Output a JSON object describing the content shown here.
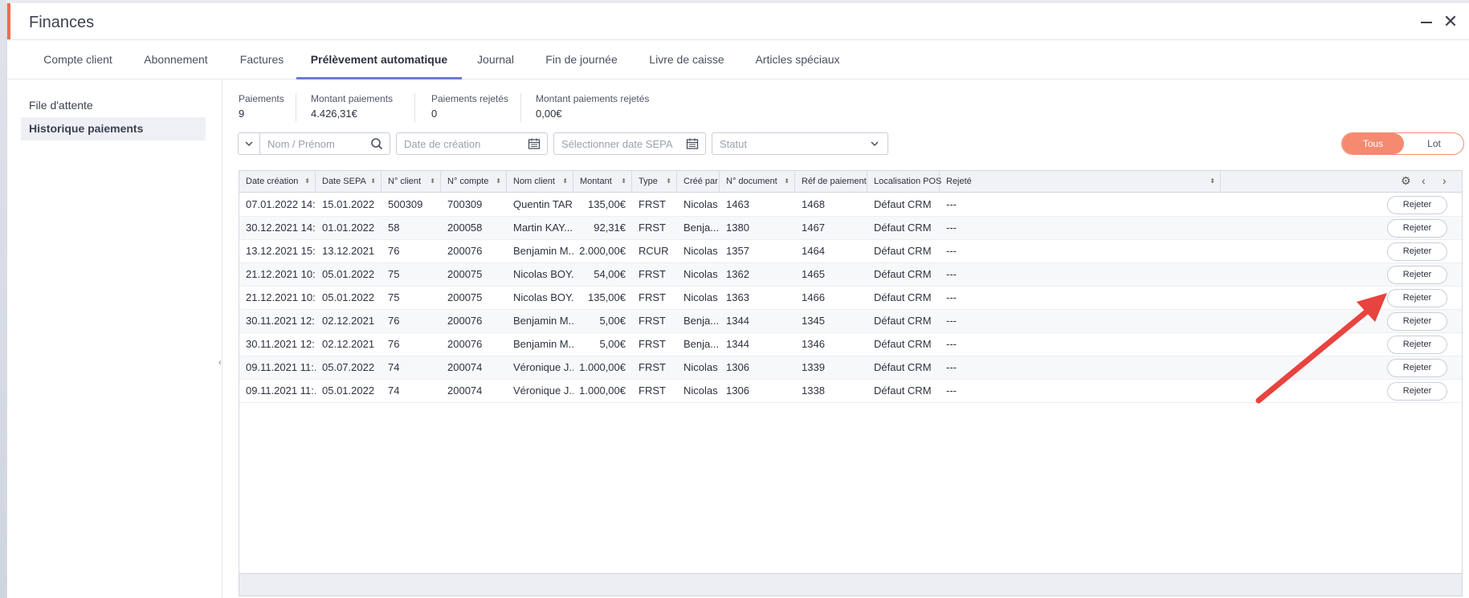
{
  "window": {
    "title": "Finances",
    "minimize_label": "—",
    "close_label": "✕"
  },
  "tabs": [
    {
      "label": "Compte client"
    },
    {
      "label": "Abonnement"
    },
    {
      "label": "Factures"
    },
    {
      "label": "Prélèvement automatique"
    },
    {
      "label": "Journal"
    },
    {
      "label": "Fin de journée"
    },
    {
      "label": "Livre de caisse"
    },
    {
      "label": "Articles spéciaux"
    }
  ],
  "active_tab": "Prélèvement automatique",
  "sidebar": {
    "items": [
      {
        "label": "File d'attente"
      },
      {
        "label": "Historique paiements"
      }
    ],
    "active": "Historique paiements"
  },
  "stats": [
    {
      "label": "Paiements",
      "value": "9"
    },
    {
      "label": "Montant paiements",
      "value": "4.426,31€"
    },
    {
      "label": "Paiements rejetés",
      "value": "0"
    },
    {
      "label": "Montant paiements rejetés",
      "value": "0,00€"
    }
  ],
  "filters": {
    "name_placeholder": "Nom / Prénom",
    "created_placeholder": "Date de création",
    "sepa_placeholder": "Sélectionner date SEPA",
    "status_placeholder": "Statut"
  },
  "toggle": {
    "all_label": "Tous",
    "batch_label": "Lot"
  },
  "table": {
    "columns": [
      "Date création",
      "Date SEPA",
      "N° client",
      "N° compte",
      "Nom client",
      "Montant",
      "Type",
      "Créé par",
      "N° document",
      "Réf de paiement",
      "Localisation POS",
      "Rejeté"
    ],
    "action_label": "Rejeter",
    "rows": [
      [
        "07.01.2022 14:...",
        "15.01.2022",
        "500309",
        "700309",
        "Quentin TAR...",
        "135,00€",
        "FRST",
        "Nicolas",
        "1463",
        "1468",
        "Défaut CRM",
        "---"
      ],
      [
        "30.12.2021 14:...",
        "01.01.2022",
        "58",
        "200058",
        "Martin KAY...",
        "92,31€",
        "FRST",
        "Benja...",
        "1380",
        "1467",
        "Défaut CRM",
        "---"
      ],
      [
        "13.12.2021 15:...",
        "13.12.2021",
        "76",
        "200076",
        "Benjamin M...",
        "2.000,00€",
        "RCUR",
        "Nicolas",
        "1357",
        "1464",
        "Défaut CRM",
        "---"
      ],
      [
        "21.12.2021 10:...",
        "05.01.2022",
        "75",
        "200075",
        "Nicolas BOY...",
        "54,00€",
        "FRST",
        "Nicolas",
        "1362",
        "1465",
        "Défaut CRM",
        "---"
      ],
      [
        "21.12.2021 10:...",
        "05.01.2022",
        "75",
        "200075",
        "Nicolas BOY...",
        "135,00€",
        "FRST",
        "Nicolas",
        "1363",
        "1466",
        "Défaut CRM",
        "---"
      ],
      [
        "30.11.2021 12:...",
        "02.12.2021",
        "76",
        "200076",
        "Benjamin M...",
        "5,00€",
        "FRST",
        "Benja...",
        "1344",
        "1345",
        "Défaut CRM",
        "---"
      ],
      [
        "30.11.2021 12:...",
        "02.12.2021",
        "76",
        "200076",
        "Benjamin M...",
        "5,00€",
        "FRST",
        "Benja...",
        "1344",
        "1346",
        "Défaut CRM",
        "---"
      ],
      [
        "09.11.2021 11:...",
        "05.07.2022",
        "74",
        "200074",
        "Véronique J...",
        "1.000,00€",
        "FRST",
        "Nicolas",
        "1306",
        "1339",
        "Défaut CRM",
        "---"
      ],
      [
        "09.11.2021 11:...",
        "05.01.2022",
        "74",
        "200074",
        "Véronique J...",
        "1.000,00€",
        "FRST",
        "Nicolas",
        "1306",
        "1338",
        "Défaut CRM",
        "---"
      ]
    ]
  },
  "colors": {
    "accent": "#f58a70",
    "tab_indicator": "#6b7bd6",
    "annotation_arrow": "#e8433f"
  }
}
